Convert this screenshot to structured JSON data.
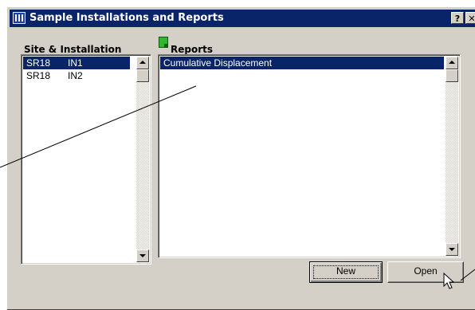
{
  "window": {
    "title": "Sample Installations and Reports",
    "help_label": "?",
    "close_label": "✕"
  },
  "site_panel": {
    "label": "Site & Installation",
    "rows": [
      {
        "site": "SR18",
        "installation": "IN1",
        "selected": true
      },
      {
        "site": "SR18",
        "installation": "IN2",
        "selected": false
      }
    ]
  },
  "reports_panel": {
    "label": "Reports",
    "icon": "report-icon",
    "rows": [
      {
        "name": "Cumulative Displacement",
        "selected": true
      }
    ]
  },
  "buttons": {
    "new_label": "New",
    "open_label": "Open"
  },
  "colors": {
    "titlebar": "#0a246a",
    "selection": "#0a246a",
    "dialog": "#d4d0c8",
    "report_icon": "#2fb82f"
  }
}
